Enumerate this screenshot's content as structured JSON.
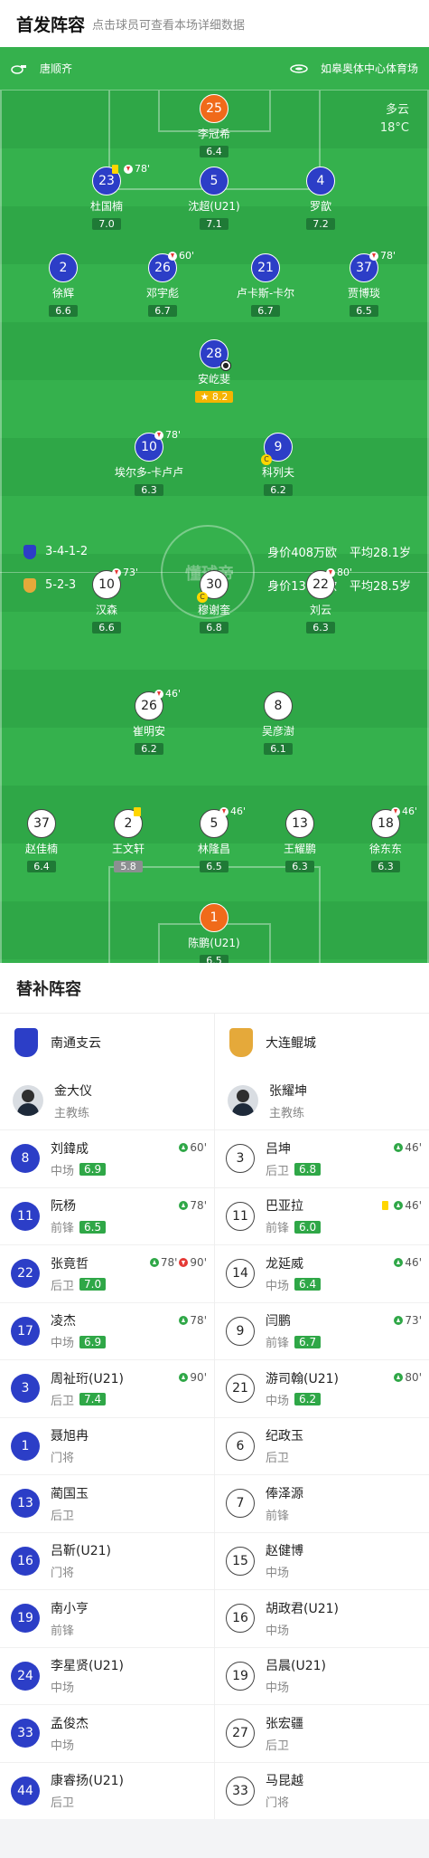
{
  "header": {
    "title": "首发阵容",
    "subtitle": "点击球员可查看本场详细数据"
  },
  "pitch_info": {
    "referee": "唐顺齐",
    "stadium": "如皋奥体中心体育场",
    "weather": "多云",
    "temperature": "18°C",
    "watermark": "懂球帝"
  },
  "home_team": {
    "formation": "3-4-1-2",
    "value": "身价408万欧",
    "age": "平均28.1岁",
    "color": "#2c3ec7"
  },
  "away_team": {
    "formation": "5-2-3",
    "value": "身价138万欧",
    "age": "平均28.5岁",
    "color": "#ffffff"
  },
  "home_players": [
    {
      "num": "25",
      "name": "李冠希",
      "rating": "6.4",
      "style": "orange"
    },
    {
      "num": "23",
      "name": "杜国楠",
      "rating": "7.0",
      "style": "blue",
      "sub": "78'",
      "yellow": true
    },
    {
      "num": "5",
      "name": "沈超(U21)",
      "rating": "7.1",
      "style": "blue"
    },
    {
      "num": "4",
      "name": "罗歆",
      "rating": "7.2",
      "style": "blue"
    },
    {
      "num": "2",
      "name": "徐辉",
      "rating": "6.6",
      "style": "blue"
    },
    {
      "num": "26",
      "name": "邓宇彪",
      "rating": "6.7",
      "style": "blue",
      "sub": "60'"
    },
    {
      "num": "21",
      "name": "卢卡斯-卡尔",
      "rating": "6.7",
      "style": "blue"
    },
    {
      "num": "37",
      "name": "贾博琰",
      "rating": "6.5",
      "style": "blue",
      "sub": "78'"
    },
    {
      "num": "28",
      "name": "安屹斐",
      "rating": "8.2",
      "style": "blue",
      "star": true
    },
    {
      "num": "10",
      "name": "埃尔多-卡卢卢",
      "rating": "6.3",
      "style": "blue",
      "sub": "78'"
    },
    {
      "num": "9",
      "name": "科列夫",
      "rating": "6.2",
      "style": "blue",
      "captain": true
    }
  ],
  "away_players": [
    {
      "num": "10",
      "name": "汉森",
      "rating": "6.6",
      "style": "white",
      "sub": "73'"
    },
    {
      "num": "30",
      "name": "穆谢奎",
      "rating": "6.8",
      "style": "white",
      "captain": true
    },
    {
      "num": "22",
      "name": "刘云",
      "rating": "6.3",
      "style": "white",
      "sub": "80'"
    },
    {
      "num": "26",
      "name": "崔明安",
      "rating": "6.2",
      "style": "white",
      "sub": "46'"
    },
    {
      "num": "8",
      "name": "吴彦澍",
      "rating": "6.1",
      "style": "white"
    },
    {
      "num": "37",
      "name": "赵佳楠",
      "rating": "6.4",
      "style": "white"
    },
    {
      "num": "2",
      "name": "王文轩",
      "rating": "5.8",
      "style": "white",
      "yellow": true
    },
    {
      "num": "5",
      "name": "林隆昌",
      "rating": "6.5",
      "style": "white",
      "sub": "46'"
    },
    {
      "num": "13",
      "name": "王耀鹏",
      "rating": "6.3",
      "style": "white"
    },
    {
      "num": "18",
      "name": "徐东东",
      "rating": "6.3",
      "style": "white",
      "sub": "46'"
    },
    {
      "num": "1",
      "name": "陈鹏(U21)",
      "rating": "6.5",
      "style": "orange"
    }
  ],
  "subs": {
    "title": "替补阵容",
    "home": {
      "team": "南通支云",
      "coach": {
        "name": "金大仪",
        "role": "主教练"
      },
      "players": [
        {
          "num": "8",
          "name": "刘鍏成",
          "pos": "中场",
          "rating": "6.9",
          "in": "60'"
        },
        {
          "num": "11",
          "name": "阮杨",
          "pos": "前锋",
          "rating": "6.5",
          "in": "78'"
        },
        {
          "num": "22",
          "name": "张竟哲",
          "pos": "后卫",
          "rating": "7.0",
          "in": "78'",
          "out": "90'"
        },
        {
          "num": "17",
          "name": "凌杰",
          "pos": "中场",
          "rating": "6.9",
          "in": "78'"
        },
        {
          "num": "3",
          "name": "周祉珩(U21)",
          "pos": "后卫",
          "rating": "7.4",
          "in": "90'"
        },
        {
          "num": "1",
          "name": "聂旭冉",
          "pos": "门将"
        },
        {
          "num": "13",
          "name": "蔺国玉",
          "pos": "后卫"
        },
        {
          "num": "16",
          "name": "吕靳(U21)",
          "pos": "门将"
        },
        {
          "num": "19",
          "name": "南小亨",
          "pos": "前锋"
        },
        {
          "num": "24",
          "name": "李星贤(U21)",
          "pos": "中场"
        },
        {
          "num": "33",
          "name": "孟俊杰",
          "pos": "中场"
        },
        {
          "num": "44",
          "name": "康睿扬(U21)",
          "pos": "后卫"
        }
      ]
    },
    "away": {
      "team": "大连鲲城",
      "coach": {
        "name": "张耀坤",
        "role": "主教练"
      },
      "players": [
        {
          "num": "3",
          "name": "吕坤",
          "pos": "后卫",
          "rating": "6.8",
          "in": "46'"
        },
        {
          "num": "11",
          "name": "巴亚拉",
          "pos": "前锋",
          "rating": "6.0",
          "in": "46'",
          "yellow": true
        },
        {
          "num": "14",
          "name": "龙延威",
          "pos": "中场",
          "rating": "6.4",
          "in": "46'"
        },
        {
          "num": "9",
          "name": "闫鹏",
          "pos": "前锋",
          "rating": "6.7",
          "in": "73'"
        },
        {
          "num": "21",
          "name": "游司翰(U21)",
          "pos": "中场",
          "rating": "6.2",
          "in": "80'"
        },
        {
          "num": "6",
          "name": "纪政玉",
          "pos": "后卫"
        },
        {
          "num": "7",
          "name": "俸泽源",
          "pos": "前锋"
        },
        {
          "num": "15",
          "name": "赵健博",
          "pos": "中场"
        },
        {
          "num": "16",
          "name": "胡政君(U21)",
          "pos": "中场"
        },
        {
          "num": "19",
          "name": "吕晨(U21)",
          "pos": "中场"
        },
        {
          "num": "27",
          "name": "张宏疆",
          "pos": "后卫"
        },
        {
          "num": "33",
          "name": "马昆越",
          "pos": "门将"
        }
      ]
    }
  }
}
